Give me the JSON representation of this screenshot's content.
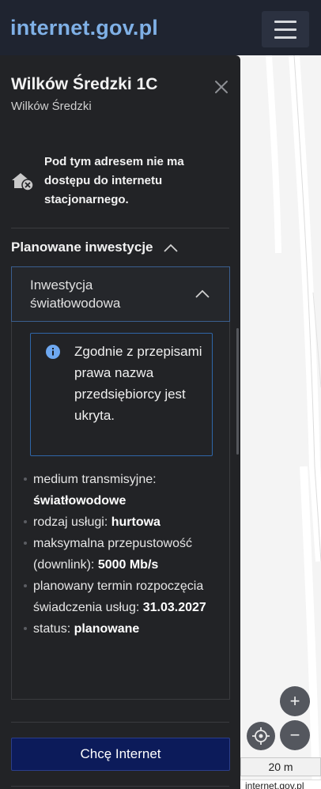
{
  "header": {
    "logo_text": "internet.gov.pl",
    "menu_icon": "hamburger-icon"
  },
  "address": {
    "title": "Wilków Średzki 1C",
    "subtitle": "Wilków Średzki"
  },
  "availability": {
    "icon": "house-no-access-icon",
    "text": "Pod tym adresem nie ma dostępu do internetu stacjonarnego."
  },
  "investments": {
    "header": "Planowane inwestycje",
    "accordion_title": "Inwestycja światłowodowa",
    "info_text": "Zgodnie z przepisami prawa nazwa przedsiębiorcy jest ukryta.",
    "details": [
      {
        "label": "medium transmisyjne: ",
        "value": "światłowodowe"
      },
      {
        "label": "rodzaj usługi: ",
        "value": "hurtowa"
      },
      {
        "label": "maksymalna przepustowość (downlink): ",
        "value": "5000 Mb/s"
      },
      {
        "label": "planowany termin rozpoczęcia świadczenia usług: ",
        "value": "31.03.2027"
      },
      {
        "label": "status: ",
        "value": "planowane"
      }
    ]
  },
  "cta": {
    "label": "Chcę Internet"
  },
  "map": {
    "zoom_in": "+",
    "zoom_out": "−",
    "scale_label": "20 m",
    "attribution": "internet.gov.pl"
  },
  "colors": {
    "header_bg": "#1f2430",
    "logo": "#7fb0e6",
    "panel_bg": "#222326",
    "cta_bg": "#0c1b5a",
    "info_border": "#2f66a8"
  }
}
